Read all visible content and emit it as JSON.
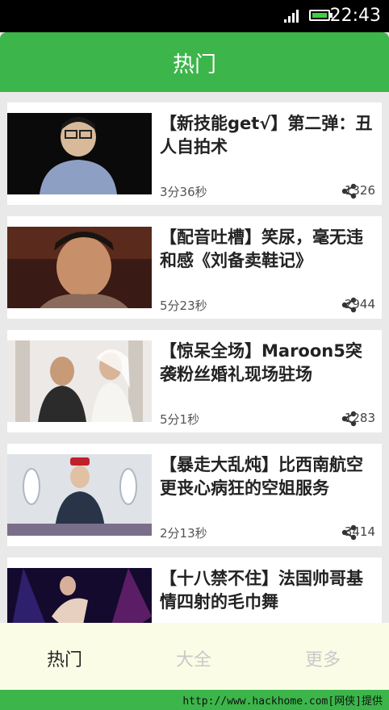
{
  "status_bar": {
    "time": "22:43"
  },
  "header": {
    "title": "热门"
  },
  "videos": [
    {
      "title": "【新技能get√】第二弹：丑人自拍术",
      "duration": "3分36秒",
      "shares": "1326"
    },
    {
      "title": "【配音吐槽】笑尿，毫无违和感《刘备卖鞋记》",
      "duration": "5分23秒",
      "shares": "2944"
    },
    {
      "title": "【惊呆全场】Maroon5突袭粉丝婚礼现场驻场",
      "duration": "5分1秒",
      "shares": "1283"
    },
    {
      "title": "【暴走大乱炖】比西南航空更丧心病狂的空姐服务",
      "duration": "2分13秒",
      "shares": "3414"
    },
    {
      "title": "【十八禁不住】法国帅哥基情四射的毛巾舞",
      "duration": "",
      "shares": ""
    }
  ],
  "tabs": [
    {
      "label": "热门"
    },
    {
      "label": "大全"
    },
    {
      "label": "更多"
    }
  ],
  "watermark": "http://www.hackhome.com[网侠]提供"
}
